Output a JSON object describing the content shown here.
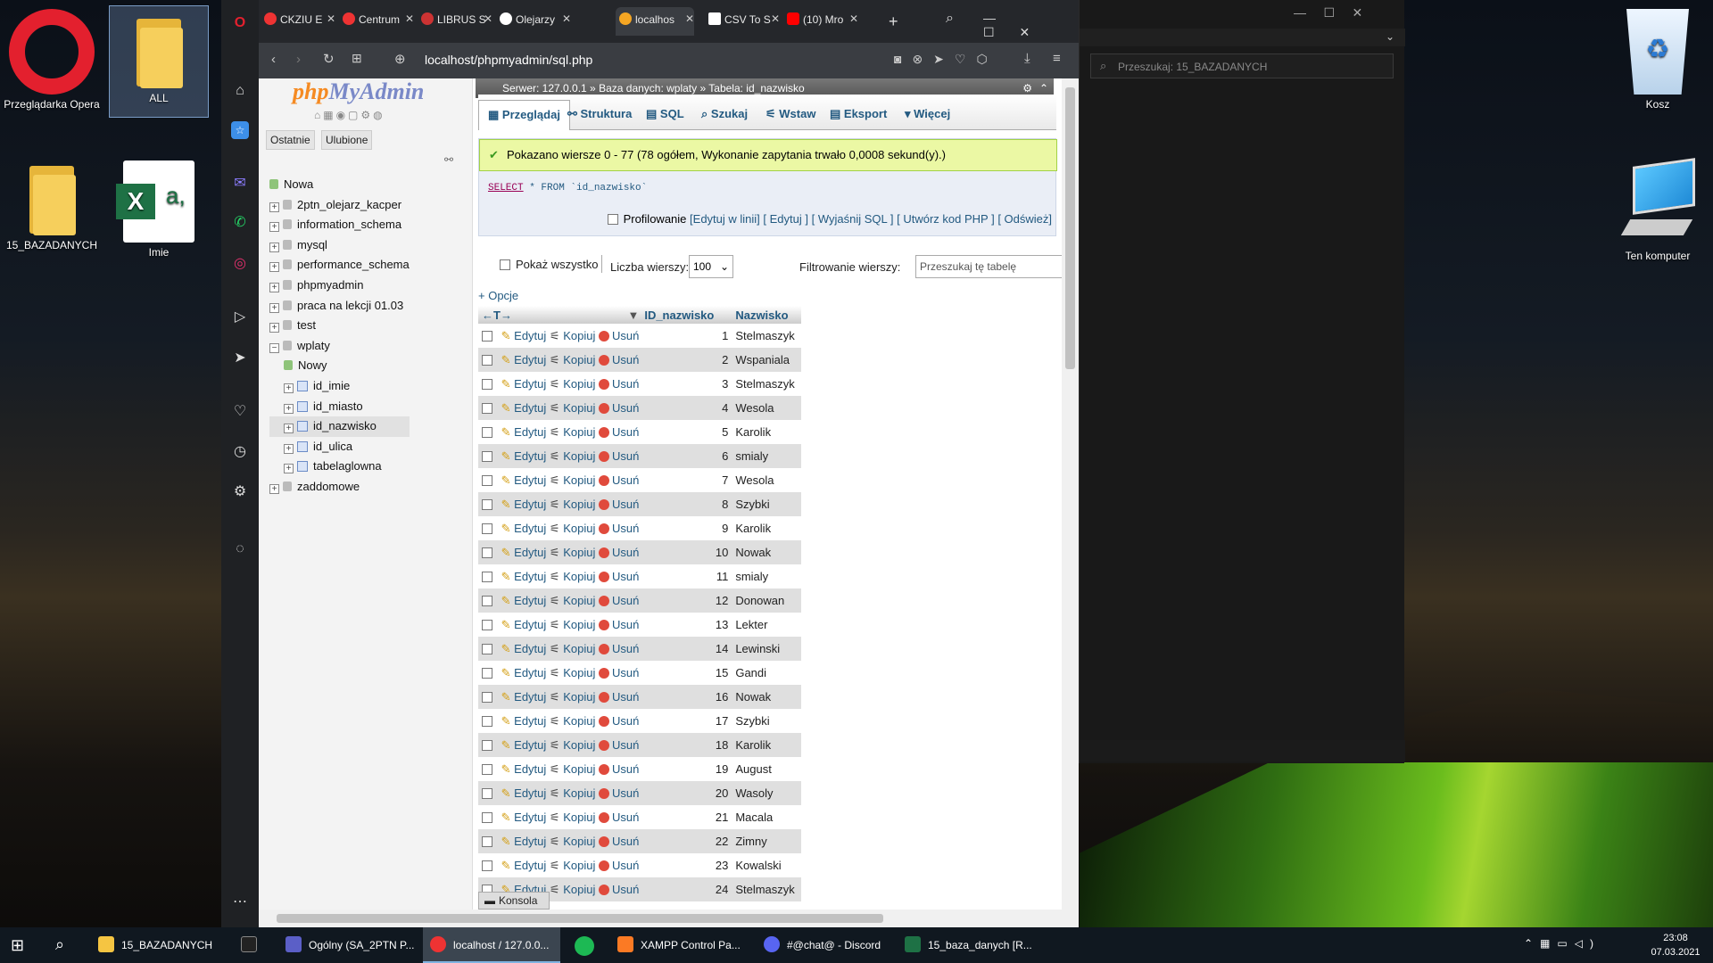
{
  "desktop": {
    "icons": [
      {
        "label": "Przeglądarka Opera"
      },
      {
        "label": "ALL"
      },
      {
        "label": "15_BAZADANYCH"
      },
      {
        "label": "Imie"
      },
      {
        "label": "Kosz"
      },
      {
        "label": "Ten komputer"
      }
    ]
  },
  "explorer": {
    "search_placeholder": "Przeszukaj: 15_BAZADANYCH"
  },
  "browser": {
    "tabs": [
      {
        "label": "CKZIU E",
        "color": "#e33"
      },
      {
        "label": "Centrum",
        "color": "#e33"
      },
      {
        "label": "LIBRUS S",
        "color": "#c33"
      },
      {
        "label": "Olejarzy",
        "color": "#fff"
      },
      {
        "label": "localhos",
        "color": "#f5a623"
      },
      {
        "label": "CSV To S",
        "color": "#fff"
      },
      {
        "label": "(10) Mro",
        "color": "#f00"
      }
    ],
    "url": "localhost/phpmyadmin/sql.php"
  },
  "pma": {
    "logo_a": "php",
    "logo_b": "MyAdmin",
    "recent_tab": "Ostatnie",
    "favorites_tab": "Ulubione",
    "tree": [
      {
        "label": "Nowa",
        "level": 0,
        "type": "new"
      },
      {
        "label": "2ptn_olejarz_kacper",
        "level": 0,
        "type": "db"
      },
      {
        "label": "information_schema",
        "level": 0,
        "type": "db"
      },
      {
        "label": "mysql",
        "level": 0,
        "type": "db"
      },
      {
        "label": "performance_schema",
        "level": 0,
        "type": "db"
      },
      {
        "label": "phpmyadmin",
        "level": 0,
        "type": "db"
      },
      {
        "label": "praca na lekcji 01.03",
        "level": 0,
        "type": "db"
      },
      {
        "label": "test",
        "level": 0,
        "type": "db"
      },
      {
        "label": "wplaty",
        "level": 0,
        "type": "dbopen"
      },
      {
        "label": "Nowy",
        "level": 1,
        "type": "new"
      },
      {
        "label": "id_imie",
        "level": 1,
        "type": "table"
      },
      {
        "label": "id_miasto",
        "level": 1,
        "type": "table"
      },
      {
        "label": "id_nazwisko",
        "level": 1,
        "type": "table",
        "selected": true
      },
      {
        "label": "id_ulica",
        "level": 1,
        "type": "table"
      },
      {
        "label": "tabelaglowna",
        "level": 1,
        "type": "table"
      },
      {
        "label": "zaddomowe",
        "level": 0,
        "type": "db"
      }
    ],
    "breadcrumb": {
      "server": "Serwer: 127.0.0.1 »",
      "database": "Baza danych: wplaty »",
      "table": "Tabela: id_nazwisko"
    },
    "menu": [
      "Przeglądaj",
      "Struktura",
      "SQL",
      "Szukaj",
      "Wstaw",
      "Eksport",
      "Więcej"
    ],
    "success": "Pokazano wiersze 0 - 77 (78 ogółem, Wykonanie zapytania trwało 0,0008 sekund(y).)",
    "sql": {
      "kw": "SELECT",
      "rest": " * FROM `id_nazwisko`"
    },
    "profiling": {
      "label": "Profilowanie",
      "links": [
        "[Edytuj w linii]",
        "[ Edytuj ]",
        "[ Wyjaśnij SQL ]",
        "[ Utwórz kod PHP ]",
        "[ Odśwież]"
      ]
    },
    "show_all": "Pokaż wszystko",
    "rows_label": "Liczba wierszy:",
    "rows_value": "100",
    "filter_label": "Filtrowanie wierszy:",
    "filter_placeholder": "Przeszukaj tę tabelę",
    "options": "+ Opcje",
    "columns": [
      "ID_nazwisko",
      "Nazwisko"
    ],
    "actions": {
      "edit": "Edytuj",
      "copy": "Kopiuj",
      "delete": "Usuń"
    },
    "rows": [
      {
        "id": "1",
        "name": "Stelmaszyk"
      },
      {
        "id": "2",
        "name": "Wspaniala"
      },
      {
        "id": "3",
        "name": "Stelmaszyk"
      },
      {
        "id": "4",
        "name": "Wesola"
      },
      {
        "id": "5",
        "name": "Karolik"
      },
      {
        "id": "6",
        "name": "smialy"
      },
      {
        "id": "7",
        "name": "Wesola"
      },
      {
        "id": "8",
        "name": "Szybki"
      },
      {
        "id": "9",
        "name": "Karolik"
      },
      {
        "id": "10",
        "name": "Nowak"
      },
      {
        "id": "11",
        "name": "smialy"
      },
      {
        "id": "12",
        "name": "Donowan"
      },
      {
        "id": "13",
        "name": "Lekter"
      },
      {
        "id": "14",
        "name": "Lewinski"
      },
      {
        "id": "15",
        "name": "Gandi"
      },
      {
        "id": "16",
        "name": "Nowak"
      },
      {
        "id": "17",
        "name": "Szybki"
      },
      {
        "id": "18",
        "name": "Karolik"
      },
      {
        "id": "19",
        "name": "August"
      },
      {
        "id": "20",
        "name": "Wasoly"
      },
      {
        "id": "21",
        "name": "Macala"
      },
      {
        "id": "22",
        "name": "Zimny"
      },
      {
        "id": "23",
        "name": "Kowalski"
      },
      {
        "id": "24",
        "name": "Stelmaszyk"
      }
    ],
    "console": "Konsola"
  },
  "taskbar": {
    "items": [
      {
        "label": "15_BAZADANYCH",
        "color": "#f5c542"
      },
      {
        "label": "",
        "color": "#222"
      },
      {
        "label": "Ogólny (SA_2PTN P...",
        "color": "#5b5fc7"
      },
      {
        "label": "localhost / 127.0.0...",
        "color": "#e33",
        "active": true
      },
      {
        "label": "",
        "color": "#1db954"
      },
      {
        "label": "XAMPP Control Pa...",
        "color": "#fb7a24"
      },
      {
        "label": "#@chat@ - Discord",
        "color": "#5865f2"
      },
      {
        "label": "15_baza_danych  [R...",
        "color": "#1e7145"
      }
    ],
    "time": "23:08",
    "date": "07.03.2021"
  }
}
